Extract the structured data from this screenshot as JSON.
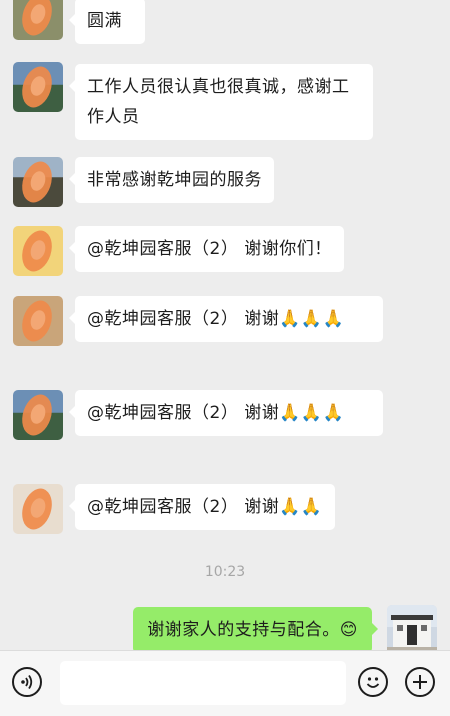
{
  "messages": [
    {
      "text": "圆满"
    },
    {
      "text": "工作人员很认真也很真诚，感谢工作人员"
    },
    {
      "text": "非常感谢乾坤园的服务"
    },
    {
      "text": "@乾坤园客服（2） 谢谢你们！"
    },
    {
      "text": "@乾坤园客服（2） 谢谢🙏🙏🙏"
    },
    {
      "text": "@乾坤园客服（2） 谢谢🙏🙏🙏"
    },
    {
      "text": "@乾坤园客服（2） 谢谢🙏🙏"
    }
  ],
  "timestamp": "10:23",
  "my_message": {
    "text": "谢谢家人的支持与配合。😊"
  },
  "input": {
    "placeholder": ""
  },
  "icons": {
    "voice": "voice-icon",
    "emoji": "emoji-icon",
    "plus": "plus-icon"
  },
  "colors": {
    "background": "#ededed",
    "my_bubble": "#95ec69",
    "their_bubble": "#ffffff",
    "accent_scribble": "#ef8a4a"
  }
}
